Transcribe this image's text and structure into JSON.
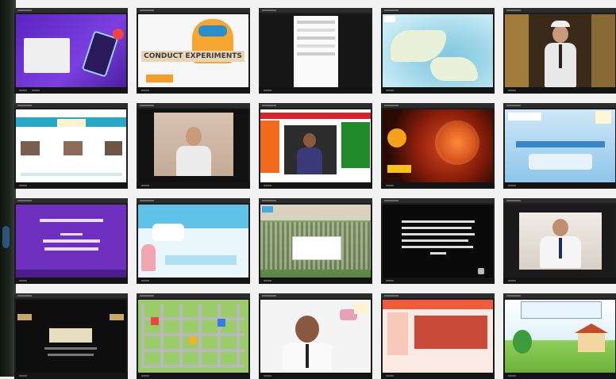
{
  "tiles": {
    "t1": {
      "text": ""
    },
    "t2": {
      "title": "CONDUCT EXPERIMENTS"
    },
    "t13": {
      "caption": ""
    },
    "t14": {
      "text": "WhatsApp"
    },
    "t19": {
      "caption": ""
    },
    "t21": {
      "title": ""
    },
    "t25": {
      "title": ""
    }
  },
  "colors": {
    "tile_bg": "#1c1c1c",
    "purple": "#5b2bb8",
    "teal": "#2d9fb3"
  }
}
